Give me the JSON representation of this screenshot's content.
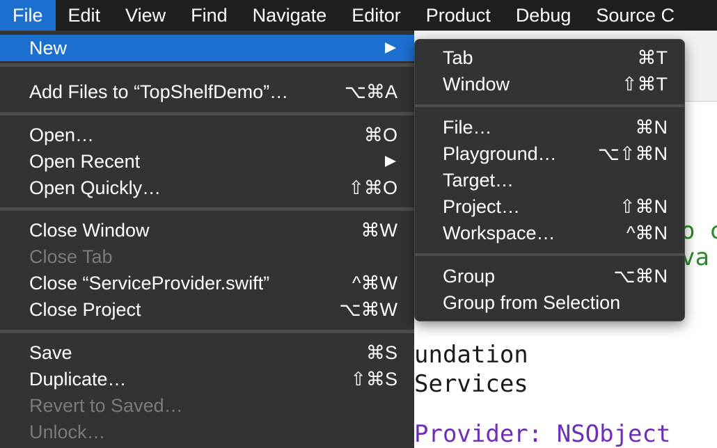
{
  "menubar": {
    "items": [
      "File",
      "Edit",
      "View",
      "Find",
      "Navigate",
      "Editor",
      "Product",
      "Debug",
      "Source C"
    ]
  },
  "file_menu": {
    "items": [
      {
        "label": "New",
        "shortcut": "",
        "submenu": true
      },
      {
        "label": "Add Files to “TopShelfDemo”…",
        "shortcut": "⌥⌘A"
      },
      {
        "label": "Open…",
        "shortcut": "⌘O"
      },
      {
        "label": "Open Recent",
        "shortcut": "",
        "submenu": true
      },
      {
        "label": "Open Quickly…",
        "shortcut": "⇧⌘O"
      },
      {
        "label": "Close Window",
        "shortcut": "⌘W"
      },
      {
        "label": "Close Tab",
        "shortcut": "",
        "disabled": true
      },
      {
        "label": "Close “ServiceProvider.swift”",
        "shortcut": "^⌘W"
      },
      {
        "label": "Close Project",
        "shortcut": "⌥⌘W"
      },
      {
        "label": "Save",
        "shortcut": "⌘S"
      },
      {
        "label": "Duplicate…",
        "shortcut": "⇧⌘S"
      },
      {
        "label": "Revert to Saved…",
        "shortcut": "",
        "disabled": true
      },
      {
        "label": "Unlock…",
        "shortcut": "",
        "disabled": true
      }
    ]
  },
  "new_submenu": {
    "items": [
      {
        "label": "Tab",
        "shortcut": "⌘T"
      },
      {
        "label": "Window",
        "shortcut": "⇧⌘T"
      },
      {
        "label": "File…",
        "shortcut": "⌘N"
      },
      {
        "label": "Playground…",
        "shortcut": "⌥⇧⌘N"
      },
      {
        "label": "Target…",
        "shortcut": ""
      },
      {
        "label": "Project…",
        "shortcut": "⇧⌘N"
      },
      {
        "label": "Workspace…",
        "shortcut": "^⌘N"
      },
      {
        "label": "Group",
        "shortcut": "⌥⌘N"
      },
      {
        "label": "Group from Selection",
        "shortcut": ""
      }
    ]
  },
  "editor": {
    "lines": [
      "o c",
      "va",
      "undation",
      "Services",
      "Provider: NSObject"
    ]
  },
  "colors": {
    "menubar_bg": "#1f1f1f",
    "menu_bg": "#333333",
    "highlight": "#1d6fcf",
    "disabled_text": "#7b7b7b",
    "code_green": "#2a8a2a",
    "code_purple": "#6e2fb8"
  }
}
